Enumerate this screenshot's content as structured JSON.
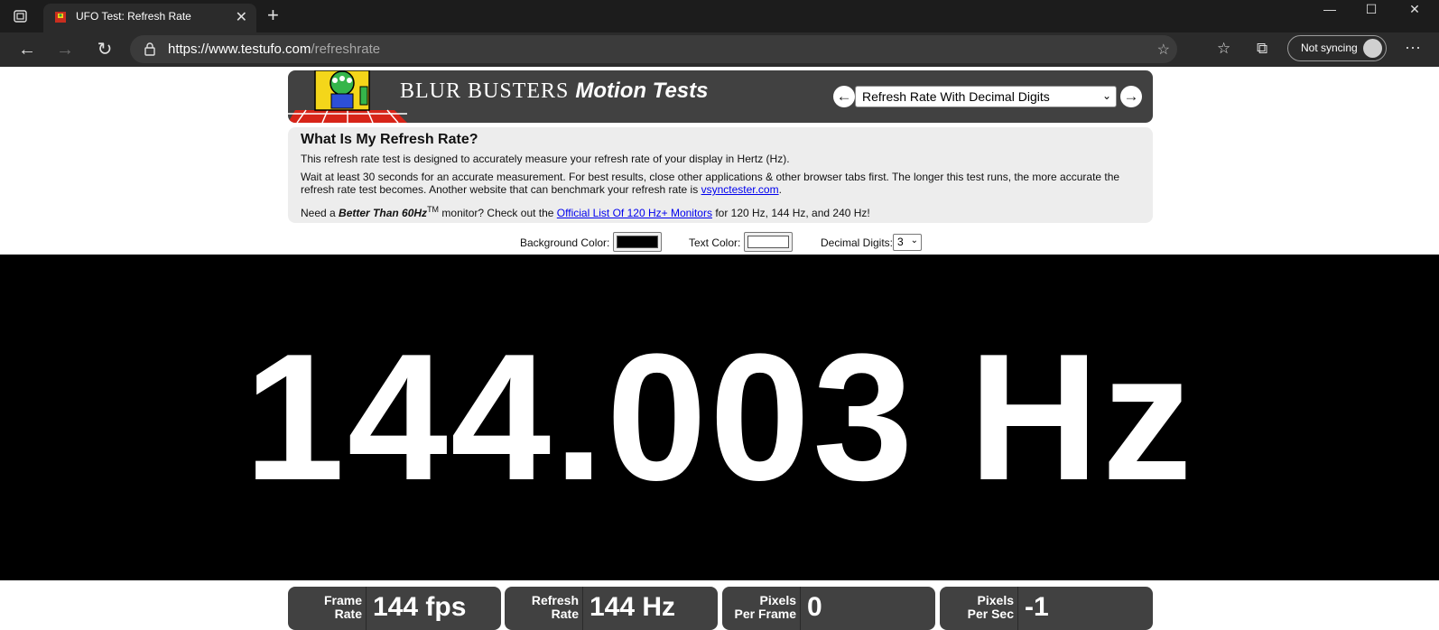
{
  "browser": {
    "tab_title": "UFO Test: Refresh Rate",
    "url_host": "https://www.testufo.com",
    "url_path": "/refreshrate",
    "sync_label": "Not syncing"
  },
  "header": {
    "brand_main": "BLUR  BUSTERS",
    "brand_sub": "Motion Tests",
    "selected_test": "Refresh Rate With Decimal Digits"
  },
  "info": {
    "title": "What Is My Refresh Rate?",
    "line1": "This refresh rate test is designed to accurately measure your refresh rate of your display in Hertz (Hz).",
    "line2_text": "Wait at least 30 seconds for an accurate measurement. For best results, close other applications & other browser tabs first. The longer this test runs, the more accurate the refresh rate test becomes. Another website that can benchmark your refresh rate is ",
    "line2_link": "vsynctester.com",
    "line2_end": ".",
    "line3_pre": "Need a ",
    "line3_bold": "Better Than 60Hz",
    "line3_sup": "TM",
    "line3_mid": " monitor? Check out the ",
    "line3_link": "Official List Of 120 Hz+ Monitors",
    "line3_end": " for 120 Hz, 144 Hz, and 240 Hz!"
  },
  "controls": {
    "bg_label": "Background Color:",
    "bg_color": "#000000",
    "text_label": "Text Color:",
    "text_color": "#ffffff",
    "digits_label": "Decimal Digits:",
    "digits_value": "3"
  },
  "readout": "144.003 Hz",
  "stats": [
    {
      "label_line1": "Frame",
      "label_line2": "Rate",
      "value": "144 fps"
    },
    {
      "label_line1": "Refresh",
      "label_line2": "Rate",
      "value": "144 Hz"
    },
    {
      "label_line1": "Pixels",
      "label_line2": "Per Frame",
      "value": "0"
    },
    {
      "label_line1": "Pixels",
      "label_line2": "Per Sec",
      "value": "-1"
    }
  ]
}
